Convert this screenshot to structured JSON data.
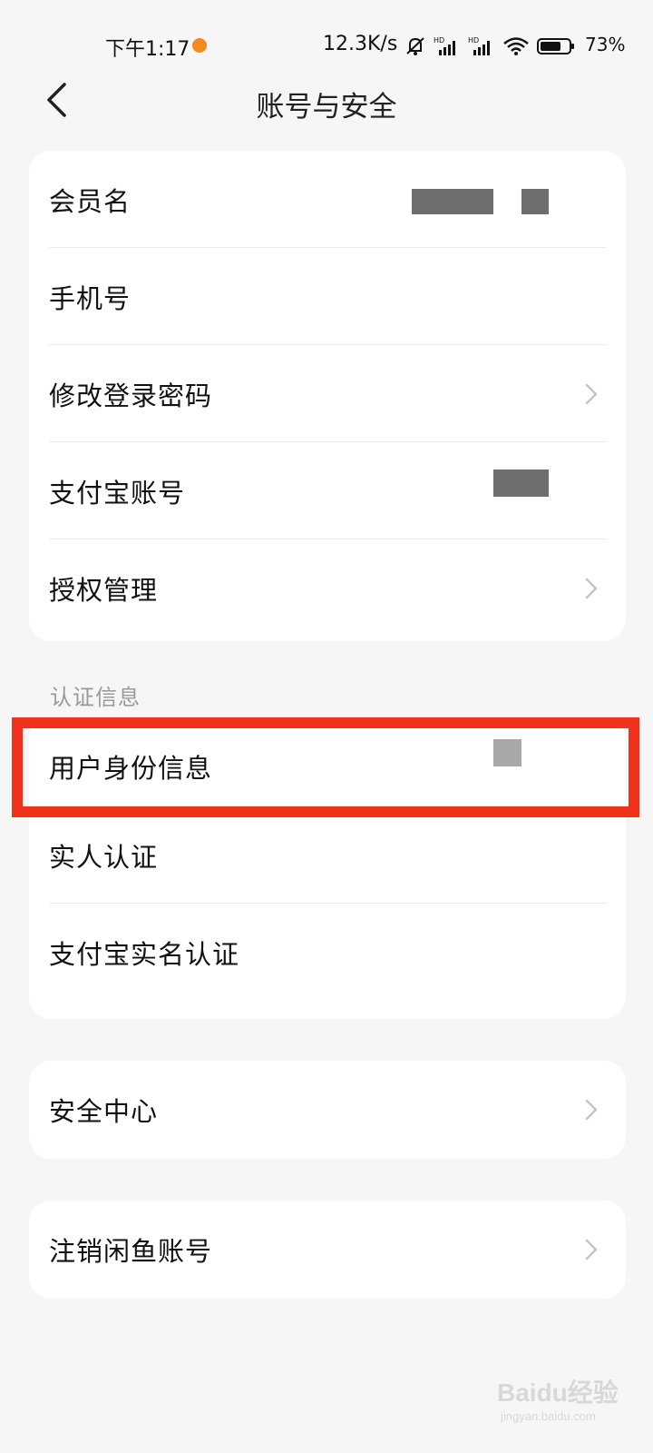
{
  "status_bar": {
    "time": "下午1:17",
    "net_speed": "12.3K/s",
    "battery": "73%",
    "icons": [
      "mute-icon",
      "signal-hd-icon",
      "signal-hd-icon",
      "wifi-icon",
      "battery-icon"
    ],
    "notification_color": "#f28a1c"
  },
  "nav": {
    "title": "账号与安全",
    "back_icon": "chevron-left-icon"
  },
  "account_card": {
    "rows": [
      {
        "label": "会员名",
        "value": ""
      },
      {
        "label": "手机号",
        "value": ""
      },
      {
        "label": "修改登录密码",
        "chevron": true
      },
      {
        "label": "支付宝账号",
        "value": ""
      },
      {
        "label": "授权管理",
        "chevron": true
      }
    ]
  },
  "verify_section": {
    "title": "认证信息",
    "rows": [
      {
        "label": "用户身份信息",
        "value": "",
        "highlighted": true
      },
      {
        "label": "实人认证",
        "value": ""
      },
      {
        "label": "支付宝实名认证",
        "value": ""
      }
    ]
  },
  "security_card": {
    "rows": [
      {
        "label": "安全中心",
        "chevron": true
      }
    ]
  },
  "close_card": {
    "rows": [
      {
        "label": "注销闲鱼账号",
        "chevron": true
      }
    ]
  },
  "watermark": {
    "text": "Baidu经验",
    "sub": "jingyan.baidu.com"
  },
  "colors": {
    "background": "#f6f6f6",
    "card": "#ffffff",
    "highlight": "#f0321c",
    "section_label": "#9a9a9a"
  }
}
